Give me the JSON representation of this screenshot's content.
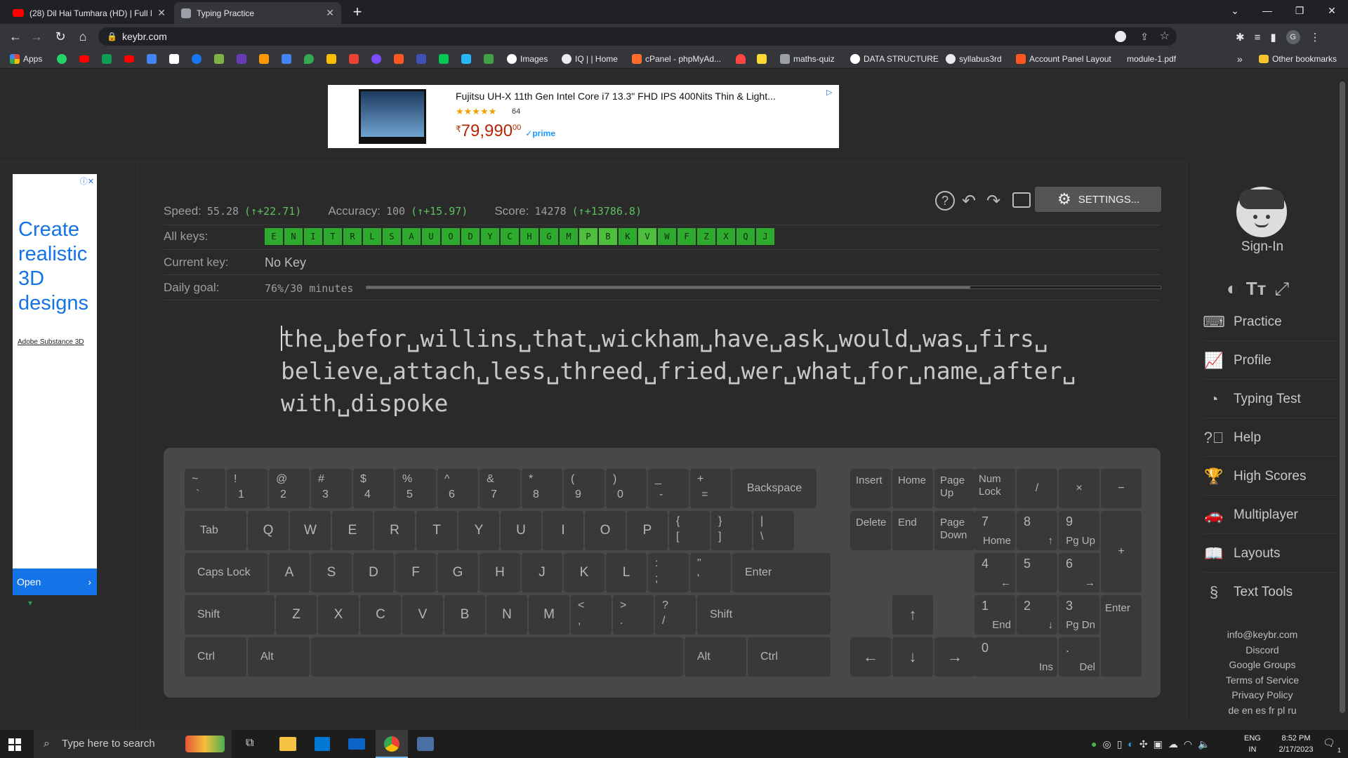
{
  "browser": {
    "tabs": [
      {
        "title": "(28) Dil Hai Tumhara (HD) | Full M"
      },
      {
        "title": "Typing Practice"
      }
    ],
    "new_tab": "+",
    "url": "keybr.com",
    "bookmarks": [
      "Apps",
      "Images",
      "IQ | | Home",
      "cPanel - phpMyAd...",
      "maths-quiz",
      "DATA STRUCTURE",
      "syllabus3rd",
      "Account Panel Layout",
      "module-1.pdf"
    ],
    "bookmarks_overflow": "»",
    "other_bookmarks": "Other bookmarks"
  },
  "ad_top": {
    "title": "Fujitsu UH-X 11th Gen Intel Core i7 13.3\" FHD IPS 400Nits Thin & Light...",
    "rating_count": "64",
    "price_symbol": "₹",
    "price": "79,990",
    "price_cents": "00",
    "prime": "✓prime",
    "stars": 4.5
  },
  "ad_left": {
    "headline": "Create realistic 3D designs",
    "brand": "Adobe Substance 3D",
    "open": "Open"
  },
  "stats": {
    "speed_label": "Speed:",
    "speed": "55.28",
    "speed_delta": "(↑+22.71)",
    "accuracy_label": "Accuracy:",
    "accuracy": "100",
    "accuracy_delta": "(↑+15.97)",
    "score_label": "Score:",
    "score": "14278",
    "score_delta": "(↑+13786.8)",
    "all_keys_label": "All keys:",
    "all_keys": [
      "E",
      "N",
      "I",
      "T",
      "R",
      "L",
      "S",
      "A",
      "U",
      "O",
      "D",
      "Y",
      "C",
      "H",
      "G",
      "M",
      "P",
      "B",
      "K",
      "V",
      "W",
      "F",
      "Z",
      "X",
      "Q",
      "J"
    ],
    "current_key_label": "Current key:",
    "current_key": "No Key",
    "daily_goal_label": "Daily goal:",
    "daily_goal": "76%/30 minutes",
    "daily_goal_fraction": 0.76
  },
  "settings_label": "SETTINGS...",
  "practice_text": {
    "line1": "the␣befor␣willins␣that␣wickham␣have␣ask␣would␣was␣firs␣",
    "line2": "believe␣attach␣less␣threed␣fried␣wer␣what␣for␣name␣after␣",
    "line3": "with␣dispoke"
  },
  "keyboard": {
    "row1": [
      [
        "~",
        "`"
      ],
      [
        "!",
        "1"
      ],
      [
        "@",
        "2"
      ],
      [
        "#",
        "3"
      ],
      [
        "$",
        "4"
      ],
      [
        "%",
        "5"
      ],
      [
        "^",
        "6"
      ],
      [
        "&",
        "7"
      ],
      [
        "*",
        "8"
      ],
      [
        "(",
        "9"
      ],
      [
        ")",
        "0"
      ],
      [
        "_",
        "-"
      ],
      [
        "+",
        "="
      ]
    ],
    "backspace": "Backspace",
    "tab": "Tab",
    "row2": [
      "Q",
      "W",
      "E",
      "R",
      "T",
      "Y",
      "U",
      "I",
      "O",
      "P"
    ],
    "row2_sym": [
      [
        "{",
        "["
      ],
      [
        "}",
        "]"
      ],
      [
        "|",
        "\\"
      ]
    ],
    "caps": "Caps Lock",
    "row3": [
      "A",
      "S",
      "D",
      "F",
      "G",
      "H",
      "J",
      "K",
      "L"
    ],
    "row3_sym": [
      [
        ":",
        ";"
      ],
      [
        "\"",
        "'"
      ]
    ],
    "enter": "Enter",
    "shift": "Shift",
    "row4": [
      "Z",
      "X",
      "C",
      "V",
      "B",
      "N",
      "M"
    ],
    "row4_sym": [
      [
        "<",
        ","
      ],
      [
        ">",
        "."
      ],
      [
        "?",
        "/"
      ]
    ],
    "ctrl": "Ctrl",
    "alt": "Alt",
    "nav": [
      "Insert",
      "Home",
      "Page Up",
      "Delete",
      "End",
      "Page Down"
    ],
    "arrows": [
      "↑",
      "←",
      "↓",
      "→"
    ],
    "numpad": {
      "numlock": "Num Lock",
      "div": "/",
      "mul": "×",
      "minus": "−",
      "plus": "+",
      "enter": "Enter",
      "n7": [
        "7",
        "Home"
      ],
      "n8": [
        "8",
        "↑"
      ],
      "n9": [
        "9",
        "Pg Up"
      ],
      "n4": [
        "4",
        "←"
      ],
      "n5": [
        "5",
        ""
      ],
      "n6": [
        "6",
        "→"
      ],
      "n1": [
        "1",
        "End"
      ],
      "n2": [
        "2",
        "↓"
      ],
      "n3": [
        "3",
        "Pg Dn"
      ],
      "n0": [
        "0",
        "Ins"
      ],
      "dot": [
        ".",
        "Del"
      ]
    }
  },
  "sidebar": {
    "signin": "Sign-In",
    "items": [
      "Practice",
      "Profile",
      "Typing Test",
      "Help",
      "High Scores",
      "Multiplayer",
      "Layouts",
      "Text Tools"
    ],
    "footer": [
      "info@keybr.com",
      "Discord",
      "Google Groups",
      "Terms of Service",
      "Privacy Policy",
      "de en es fr pl ru"
    ]
  },
  "taskbar": {
    "search_placeholder": "Type here to search",
    "lang": "ENG",
    "region": "IN",
    "time": "8:52 PM",
    "date": "2/17/2023",
    "notif_count": "1"
  },
  "colors": {
    "accent_green": "#2eaa2e",
    "delta_green": "#5fbf5f",
    "page_bg": "#2a2a2a",
    "keyboard_bg": "#4a4747"
  }
}
